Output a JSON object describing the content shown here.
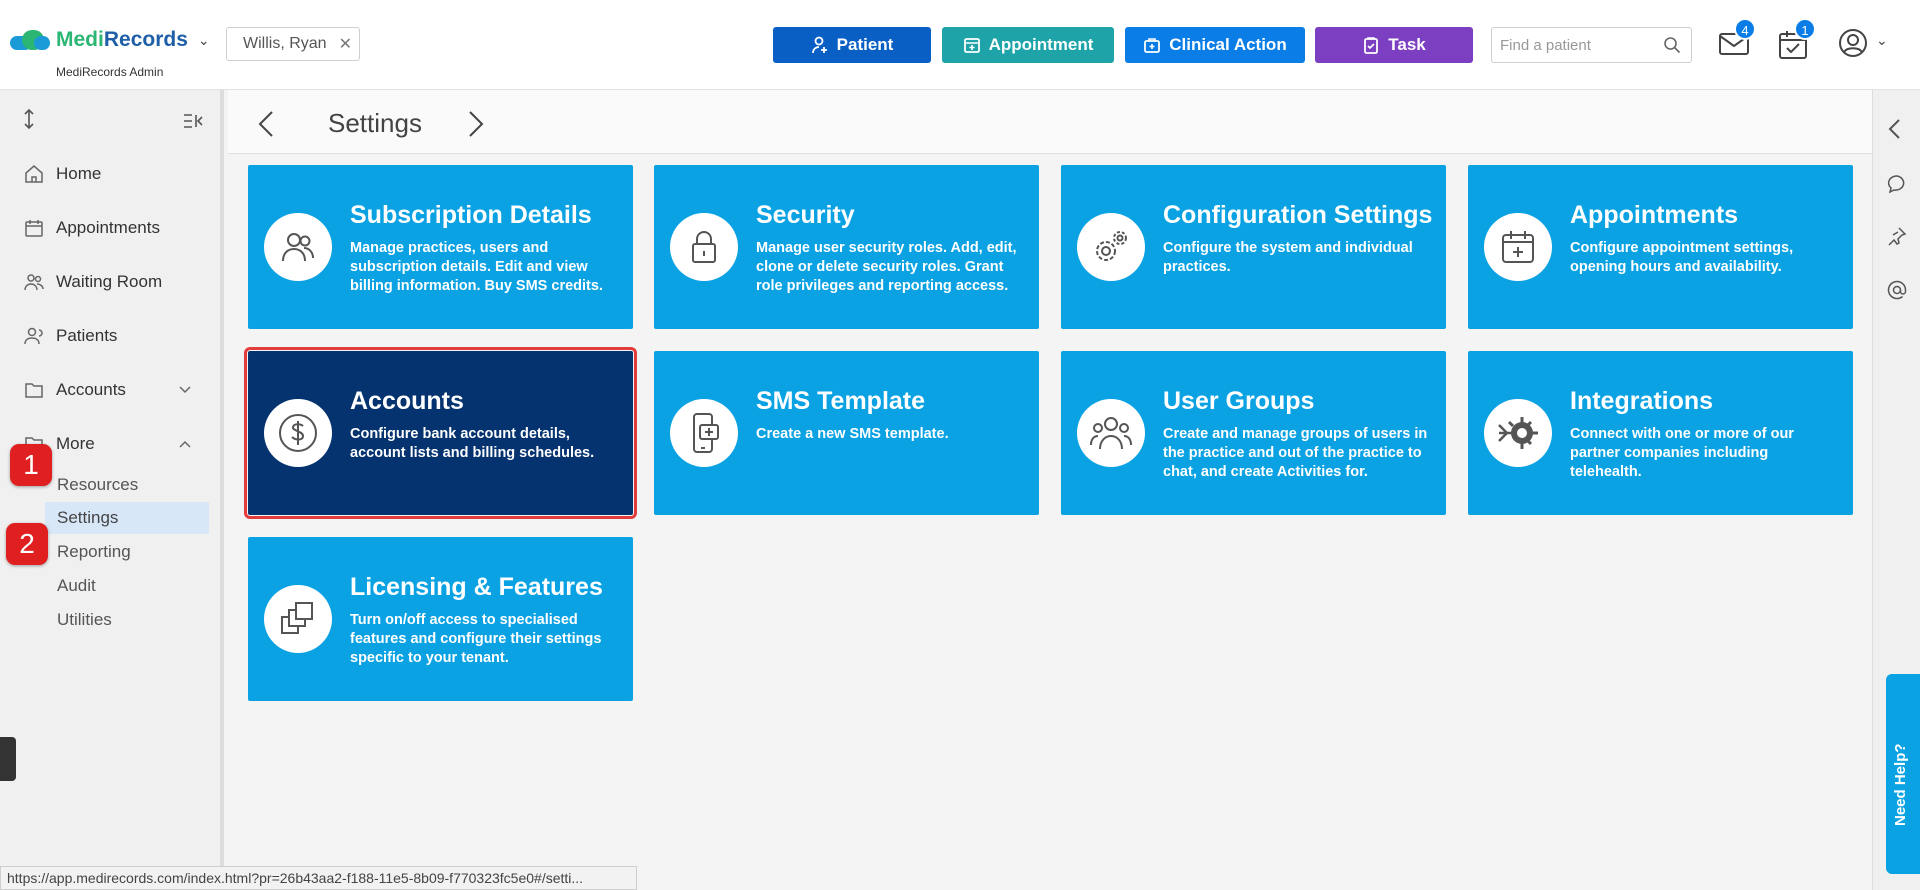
{
  "header": {
    "brand_part1": "Medi",
    "brand_part2": "Records",
    "brand_sub": "MediRecords Admin",
    "current_patient": "Willis, Ryan",
    "buttons": {
      "patient": "Patient",
      "appointment": "Appointment",
      "clinical_action": "Clinical Action",
      "task": "Task"
    },
    "search_placeholder": "Find a patient",
    "mail_count": "4",
    "tasks_count": "1"
  },
  "sidebar": {
    "items": [
      {
        "label": "Home"
      },
      {
        "label": "Appointments"
      },
      {
        "label": "Waiting Room"
      },
      {
        "label": "Patients"
      },
      {
        "label": "Accounts"
      },
      {
        "label": "More"
      }
    ],
    "more_items": [
      {
        "label": "Resources"
      },
      {
        "label": "Settings"
      },
      {
        "label": "Reporting"
      },
      {
        "label": "Audit"
      },
      {
        "label": "Utilities"
      }
    ],
    "step_markers": [
      "1",
      "2"
    ]
  },
  "page": {
    "title": "Settings"
  },
  "tiles": [
    {
      "title": "Subscription Details",
      "desc": "Manage practices, users and subscription details. Edit and view billing information. Buy SMS credits."
    },
    {
      "title": "Security",
      "desc": "Manage user security roles. Add, edit, clone or delete security roles. Grant role privileges and reporting access."
    },
    {
      "title": "Configuration Settings",
      "desc": "Configure the system and individual practices."
    },
    {
      "title": "Appointments",
      "desc": "Configure appointment settings, opening hours and availability."
    },
    {
      "title": "Accounts",
      "desc": "Configure bank account details, account lists and billing schedules."
    },
    {
      "title": "SMS Template",
      "desc": "Create a new SMS template."
    },
    {
      "title": "User Groups",
      "desc": "Create and manage groups of users in the practice and out of the practice to chat, and create Activities for."
    },
    {
      "title": "Integrations",
      "desc": "Connect with one or more of our partner companies including telehealth."
    },
    {
      "title": "Licensing & Features",
      "desc": "Turn on/off access to specialised features and configure their settings specific to your tenant."
    }
  ],
  "status_url": "https://app.medirecords.com/index.html?pr=26b43aa2-f188-11e5-8b09-f770323fc5e0#/setti...",
  "help_label": "Need Help?",
  "colors": {
    "tile": "#0aa2e3",
    "tile_selected": "#04336f",
    "highlight": "#e23d3d"
  }
}
